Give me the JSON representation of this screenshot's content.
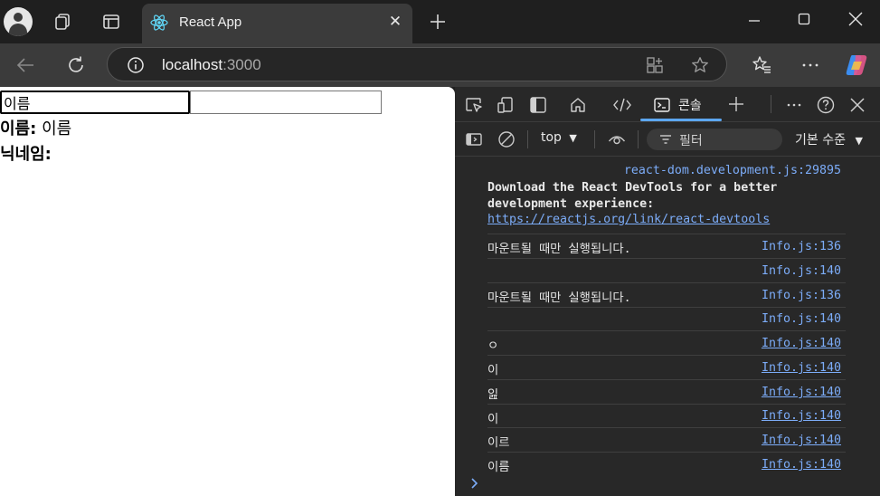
{
  "browser": {
    "tab_title": "React App",
    "url_host": "localhost",
    "url_port": ":3000"
  },
  "page": {
    "name_input_value": "이름",
    "nickname_input_value": "",
    "name_label": "이름:",
    "name_value": "이름",
    "nickname_label": "닉네임:",
    "nickname_value": ""
  },
  "devtools": {
    "console_tab_label": "콘솔",
    "context": "top",
    "filter_placeholder": "필터",
    "levels_label": "기본 수준",
    "welcome": {
      "source": "react-dom.development.js:29895",
      "text_line1": "Download the React DevTools for a better",
      "text_line2": "development experience:",
      "link": "https://reactjs.org/link/react-devtools"
    },
    "messages": [
      {
        "text": "마운트될 때만 실행됩니다.",
        "source": "Info.js:136"
      },
      {
        "text": "",
        "source": "Info.js:140"
      },
      {
        "text": "마운트될 때만 실행됩니다.",
        "source": "Info.js:136"
      },
      {
        "text": "",
        "source": "Info.js:140"
      },
      {
        "text": "ㅇ",
        "source": "Info.js:140"
      },
      {
        "text": "이",
        "source": "Info.js:140"
      },
      {
        "text": "잂",
        "source": "Info.js:140"
      },
      {
        "text": "이",
        "source": "Info.js:140"
      },
      {
        "text": "이르",
        "source": "Info.js:140"
      },
      {
        "text": "이름",
        "source": "Info.js:140"
      }
    ]
  },
  "colors": {
    "accent": "#5da7f0",
    "link": "#7cacf8"
  }
}
